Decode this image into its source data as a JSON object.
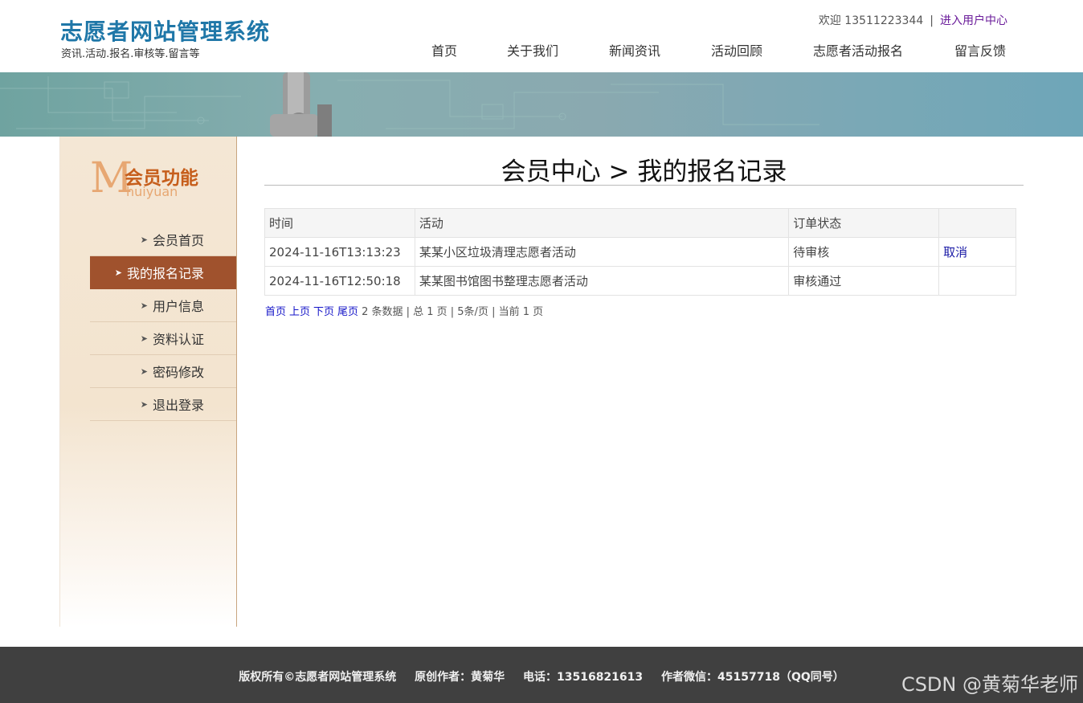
{
  "site": {
    "title": "志愿者网站管理系统",
    "subtitle": "资讯.活动.报名.审核等.留言等"
  },
  "top_links": {
    "welcome": "欢迎 13511223344",
    "separator": "|",
    "user_center": "进入用户中心"
  },
  "nav": {
    "items": [
      "首页",
      "关于我们",
      "新闻资讯",
      "活动回顾",
      "志愿者活动报名",
      "留言反馈"
    ]
  },
  "sidebar": {
    "logo_letter": "M",
    "logo_cn": "会员功能",
    "logo_en": "huiyuan",
    "items": [
      {
        "label": "会员首页",
        "active": false
      },
      {
        "label": "我的报名记录",
        "active": true
      },
      {
        "label": "用户信息",
        "active": false
      },
      {
        "label": "资料认证",
        "active": false
      },
      {
        "label": "密码修改",
        "active": false
      },
      {
        "label": "退出登录",
        "active": false
      }
    ]
  },
  "main": {
    "title": "会员中心 > 我的报名记录",
    "table": {
      "headers": [
        "时间",
        "活动",
        "订单状态",
        ""
      ],
      "rows": [
        {
          "time": "2024-11-16T13:13:23",
          "activity": "某某小区垃圾清理志愿者活动",
          "status": "待审核",
          "action": "取消"
        },
        {
          "time": "2024-11-16T12:50:18",
          "activity": "某某图书馆图书整理志愿者活动",
          "status": "审核通过",
          "action": ""
        }
      ]
    },
    "pager": {
      "first": "首页",
      "prev": "上页",
      "next": "下页",
      "last": "尾页",
      "summary": "2 条数据 | 总 1 页 | 5条/页 | 当前 1 页"
    }
  },
  "footer": {
    "copyright": "版权所有©志愿者网站管理系统",
    "author": "原创作者：黄菊华",
    "phone": "电话：13516821613",
    "wechat": "作者微信：45157718（QQ同号）"
  },
  "watermark": "CSDN @黄菊华老师",
  "colors": {
    "brand_blue": "#1f77a8",
    "sidebar_active": "#a0522d",
    "pending_red": "#e10000",
    "footer_bg": "#404040"
  }
}
